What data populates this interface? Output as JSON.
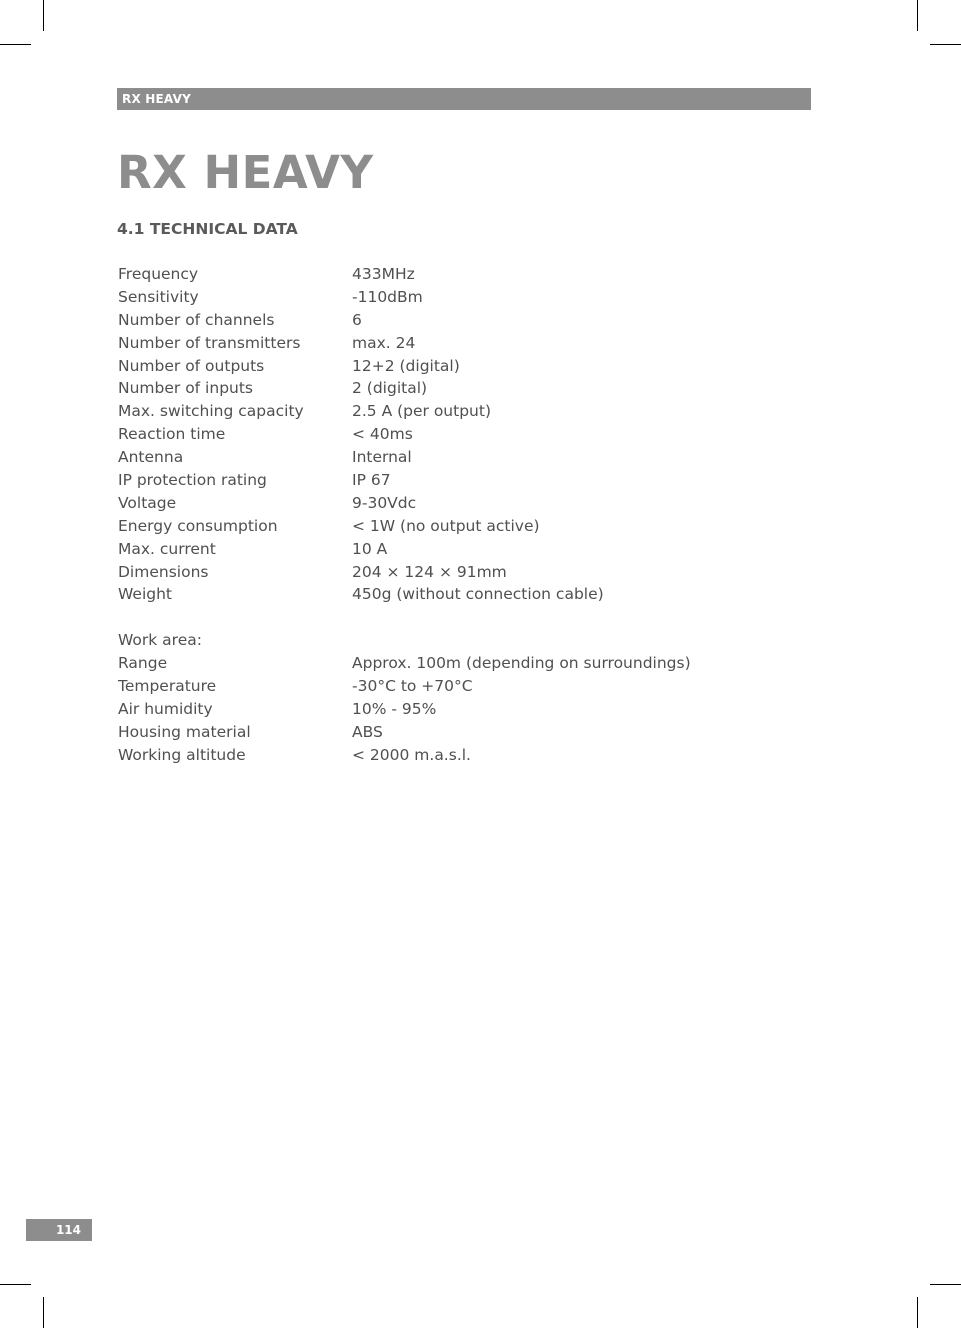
{
  "header": {
    "running_title": "RX HEAVY"
  },
  "page_title": "RX HEAVY",
  "section": {
    "title": "4.1  TECHNICAL DATA"
  },
  "specs": [
    {
      "label": "Frequency",
      "value": "433MHz"
    },
    {
      "label": "Sensitivity",
      "value": "-110dBm"
    },
    {
      "label": "Number of channels",
      "value": "6"
    },
    {
      "label": "Number of transmitters",
      "value": "max. 24"
    },
    {
      "label": "Number of outputs",
      "value": "12+2 (digital)"
    },
    {
      "label": "Number of inputs",
      "value": "2 (digital)"
    },
    {
      "label": "Max. switching capacity",
      "value": "2.5 A (per output)"
    },
    {
      "label": "Reaction time",
      "value": "< 40ms"
    },
    {
      "label": "Antenna",
      "value": "Internal"
    },
    {
      "label": "IP protection rating",
      "value": "IP 67"
    },
    {
      "label": "Voltage",
      "value": "9-30Vdc"
    },
    {
      "label": "Energy consumption",
      "value": "< 1W (no output active)"
    },
    {
      "label": "Max. current",
      "value": "10 A"
    },
    {
      "label": "Dimensions",
      "value": "204 × 124 × 91mm"
    },
    {
      "label": "Weight",
      "value": "450g (without connection cable)"
    }
  ],
  "work_area": {
    "heading": "Work area:",
    "specs": [
      {
        "label": "Range",
        "value": "Approx. 100m (depending on surroundings)"
      },
      {
        "label": "Temperature",
        "value": "-30°C to +70°C"
      },
      {
        "label": "Air humidity",
        "value": "10% - 95%"
      },
      {
        "label": "Housing material",
        "value": "ABS"
      },
      {
        "label": "Working altitude",
        "value": "< 2000 m.a.s.l."
      }
    ]
  },
  "footer": {
    "page_number": "114"
  }
}
